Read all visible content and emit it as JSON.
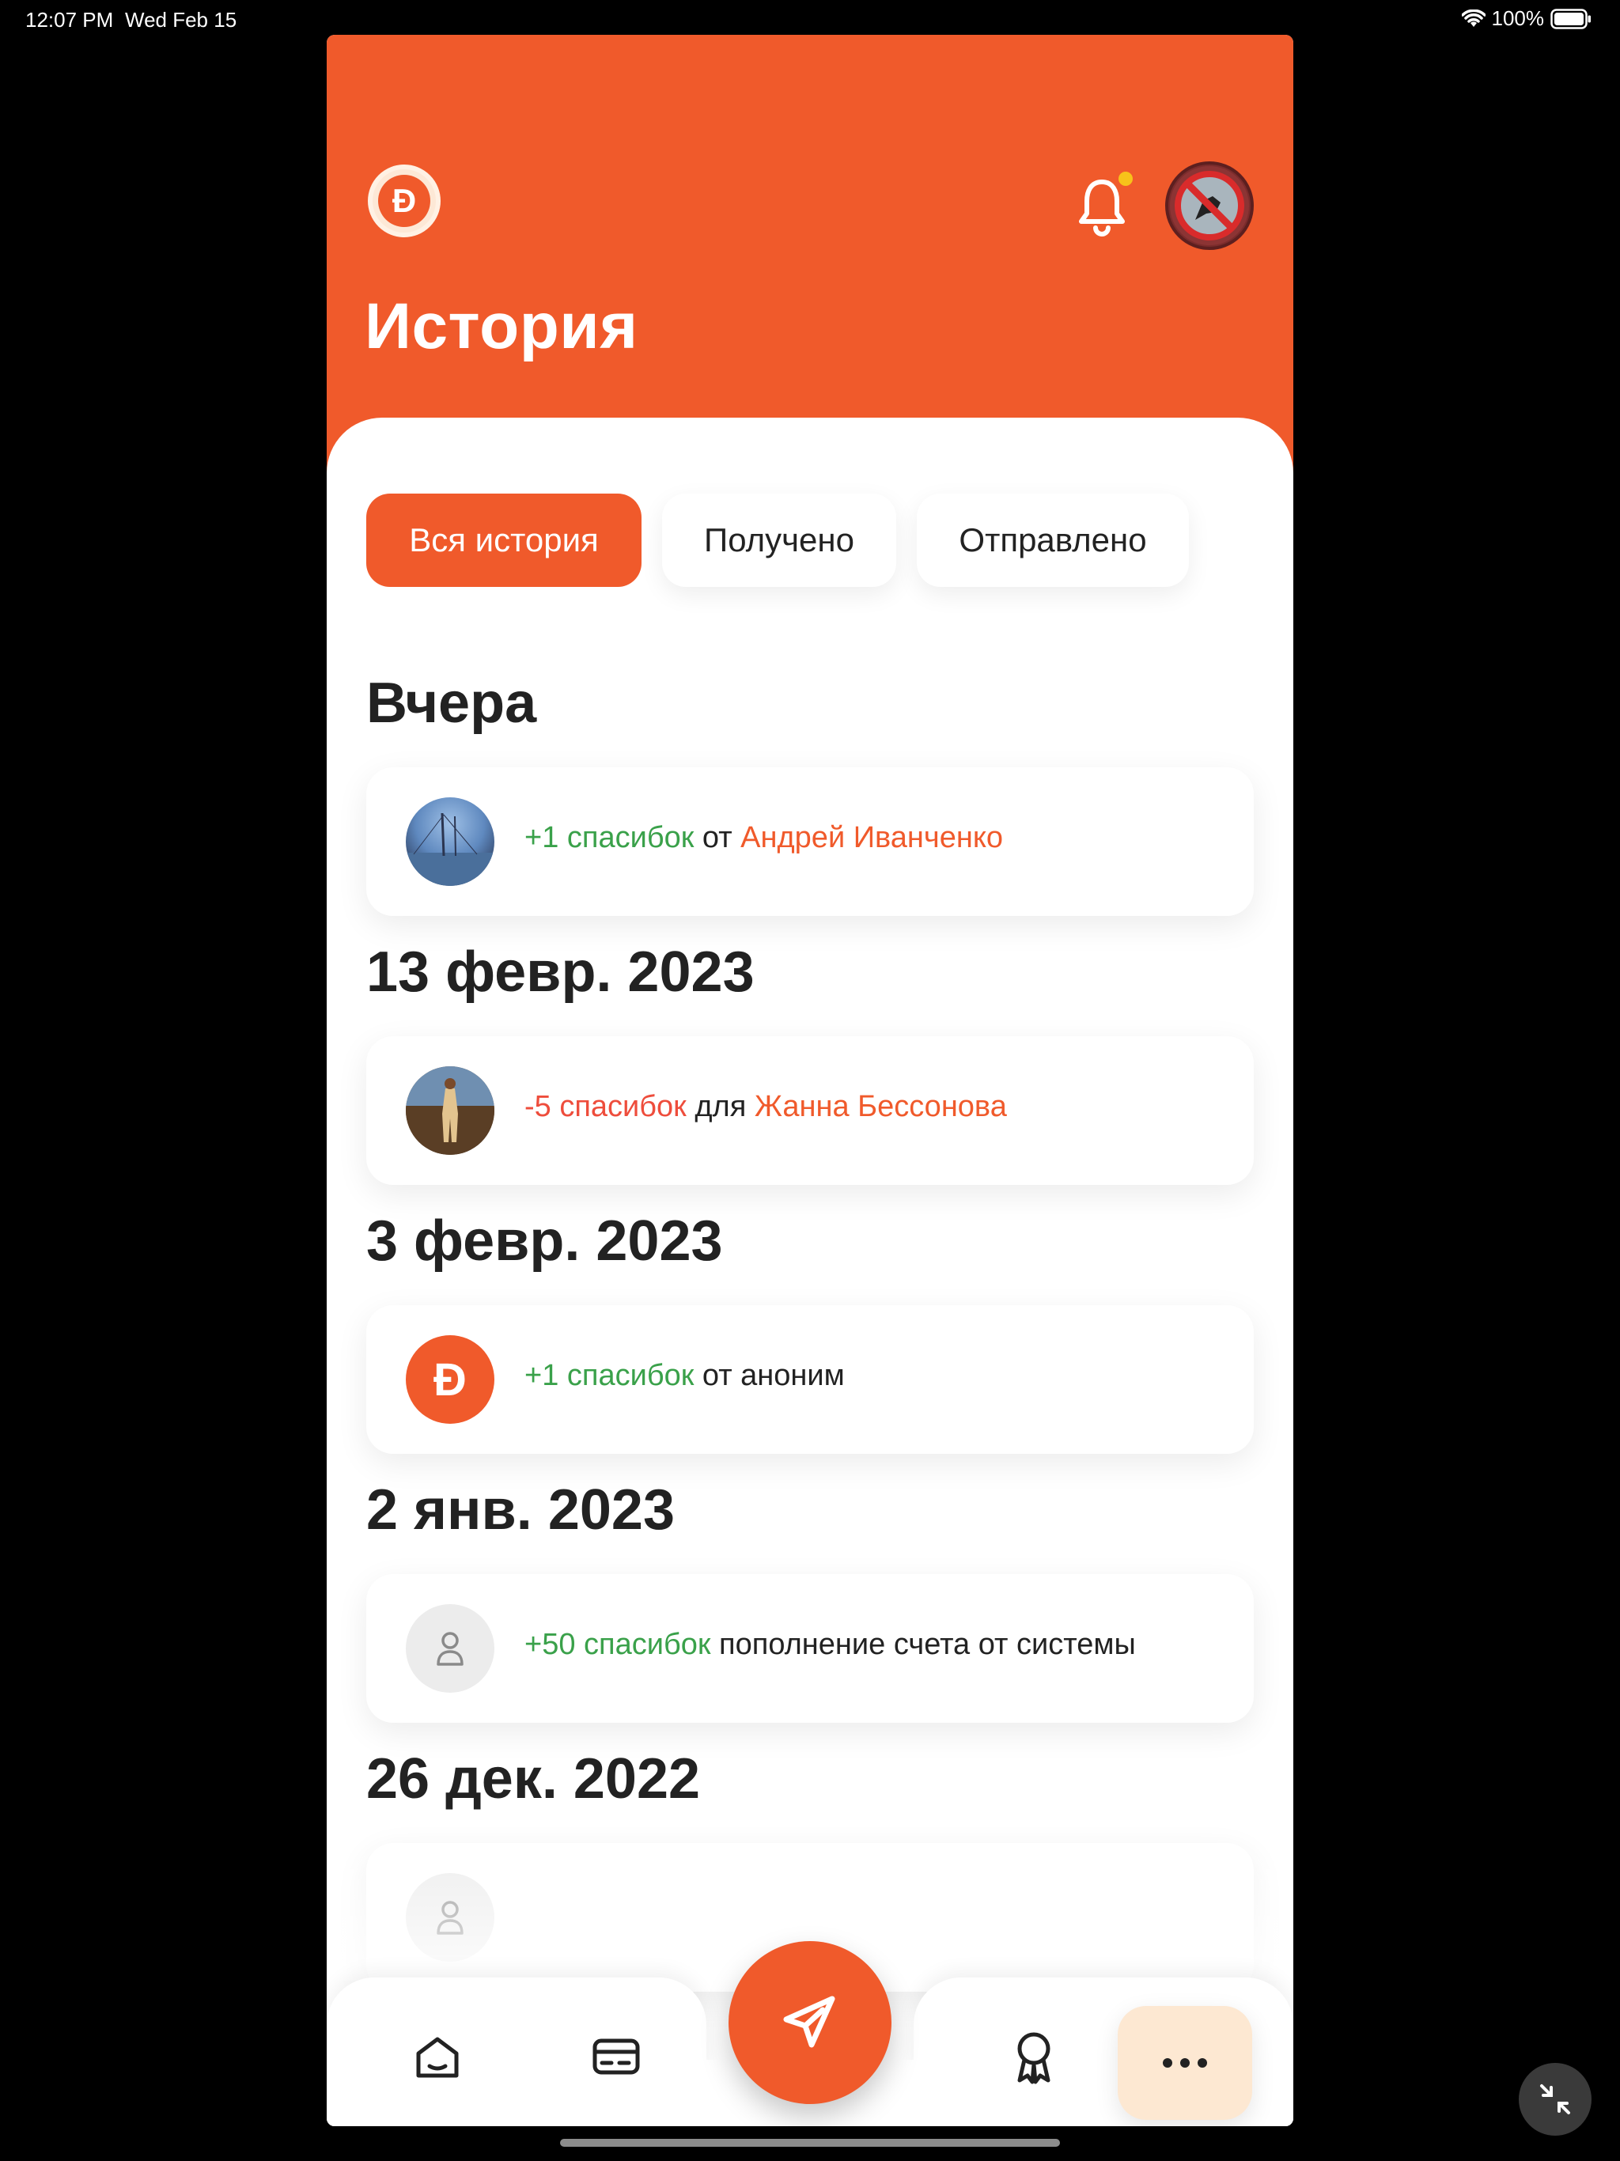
{
  "status": {
    "time": "12:07 PM",
    "date": "Wed Feb 15",
    "battery": "100%"
  },
  "header": {
    "logo": "Đ",
    "title": "История"
  },
  "tabs": [
    {
      "label": "Вся история",
      "active": true
    },
    {
      "label": "Получено",
      "active": false
    },
    {
      "label": "Отправлено",
      "active": false
    }
  ],
  "sections": [
    {
      "date": "Вчера",
      "item": {
        "amount": "+1 спасибок",
        "connector": "от",
        "person": "Андрей Иванченко",
        "avatar": "photo-avatar"
      }
    },
    {
      "date": "13 февр. 2023",
      "item": {
        "amount": "-5 спасибок",
        "connector": "для",
        "person": "Жанна Бессонова",
        "avatar": "photo-avatar"
      }
    },
    {
      "date": "3 февр. 2023",
      "item": {
        "amount": "+1 спасибок",
        "connector": "от аноним",
        "person": "",
        "avatar": "brand-avatar",
        "avatar_text": "Đ"
      }
    },
    {
      "date": "2 янв. 2023",
      "item": {
        "amount": "+50 спасибок",
        "connector": "пополнение счета от системы",
        "person": "",
        "avatar": "user-icon"
      }
    },
    {
      "date": "26 дек. 2022",
      "item": {
        "amount": "",
        "connector": "",
        "person": "",
        "avatar": "user-icon"
      }
    }
  ],
  "bottom_nav": {
    "items": [
      "home-icon",
      "card-icon",
      "send-icon",
      "award-icon",
      "more-icon"
    ]
  },
  "colors": {
    "accent": "#f05a2b",
    "positive": "#3aa14a",
    "negative": "#ee4d3c",
    "notification": "#f7c21a"
  }
}
